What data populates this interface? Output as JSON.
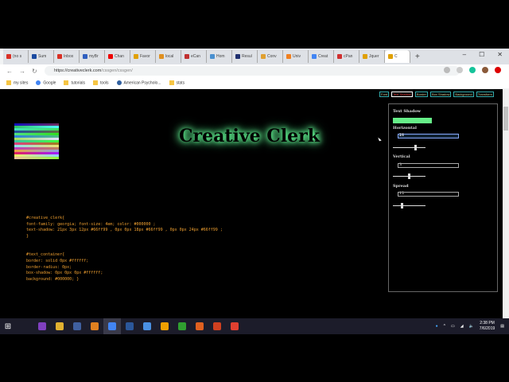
{
  "browser": {
    "tabs": [
      {
        "label": "(no s",
        "color": "#d93025"
      },
      {
        "label": "Sum",
        "color": "#1a4aa0"
      },
      {
        "label": "Inbox",
        "color": "#d93025"
      },
      {
        "label": "myBr",
        "color": "#3060c0"
      },
      {
        "label": "Chan",
        "color": "#e00"
      },
      {
        "label": "Favor",
        "color": "#e0a000"
      },
      {
        "label": "local",
        "color": "#e09020"
      },
      {
        "label": "eCan",
        "color": "#c03030"
      },
      {
        "label": "Hom",
        "color": "#4a90d0"
      },
      {
        "label": "Resul",
        "color": "#203070"
      },
      {
        "label": "Conv",
        "color": "#e0a030"
      },
      {
        "label": "Univ",
        "color": "#f08020"
      },
      {
        "label": "Creat",
        "color": "#4285f4"
      },
      {
        "label": "cPan",
        "color": "#d03030"
      },
      {
        "label": "Jquer",
        "color": "#e0a000"
      },
      {
        "label": "C",
        "color": "#e0a000",
        "active": true
      }
    ],
    "new_tab": "+",
    "window_controls": [
      "–",
      "☐",
      "✕"
    ],
    "url_host": "https://creativeclerk.com",
    "url_path": "/cssgen/cssgen/",
    "bookmarks": [
      {
        "label": "my sites",
        "icon": "folder"
      },
      {
        "label": "Google",
        "icon": "google"
      },
      {
        "label": "tutorials",
        "icon": "folder"
      },
      {
        "label": "tools",
        "icon": "folder"
      },
      {
        "label": "American Psycholo...",
        "icon": "globe"
      },
      {
        "label": "stats",
        "icon": "folder"
      }
    ]
  },
  "page": {
    "title": "Creative Clerk",
    "swatch_colors": [
      "#1010c0",
      "#30c060",
      "#40e0c0",
      "#2050a0",
      "#50e080",
      "#3080e0",
      "#a0e060",
      "#40c0a0",
      "#e04080",
      "#90e0f0",
      "#c040c0",
      "#f0a040",
      "#e02060",
      "#f0f060",
      "#f0c0a0"
    ],
    "top_tabs": [
      {
        "label": "Font"
      },
      {
        "label": "Text Shadow",
        "active": true
      },
      {
        "label": "Border"
      },
      {
        "label": "Box Shadow"
      },
      {
        "label": "Background"
      },
      {
        "label": "Transform"
      }
    ],
    "code_lines": [
      "#creative_clerk{",
      "font-family: georgia; font-size: 4em; color: #000000 ;",
      "text-shadow: 21px 3px 12px #66ff99 , 0px 0px 18px #66ff99 , 0px 0px 24px #66ff99 ;",
      "}",
      "",
      "",
      "#text_container{",
      "border: solid 0px #ffffff;",
      "border-radius: 0px;",
      "box-shadow: 0px 0px 0px #ffffff;",
      "background: #000000; }"
    ],
    "panel": {
      "heading": "Text Shadow",
      "shadow_color": "#66ee88",
      "horizontal": {
        "label": "Horizontal",
        "value": "21",
        "slider": 0.7
      },
      "vertical": {
        "label": "Vertical",
        "value": "3",
        "slider": 0.5
      },
      "spread": {
        "label": "Spread",
        "value": "12",
        "slider": 0.25
      }
    }
  },
  "taskbar": {
    "apps": [
      "#8040c0",
      "#e0b030",
      "#4060a0",
      "#e08020",
      "#4285f4",
      "#2b579a",
      "#4a90e2",
      "#f0a000",
      "#30a030",
      "#e06020",
      "#d04020",
      "#e04030"
    ],
    "time": "2:38 PM",
    "date": "7/6/2019"
  }
}
